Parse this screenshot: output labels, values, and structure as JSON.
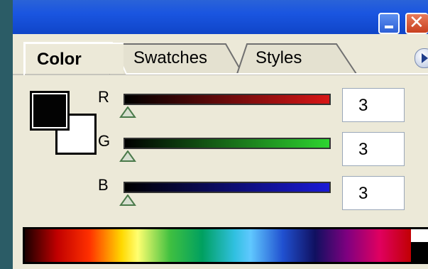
{
  "window": {
    "title_buttons": {
      "minimize_icon": "minimize-icon",
      "close_icon": "close-icon",
      "close_glyph": "✕"
    }
  },
  "tabs": [
    {
      "label": "Color",
      "active": true
    },
    {
      "label": "Swatches",
      "active": false
    },
    {
      "label": "Styles",
      "active": false
    }
  ],
  "panel_menu_icon": "panel-menu-icon",
  "swatches": {
    "foreground": "#030303",
    "background": "#ffffff"
  },
  "channels": [
    {
      "label": "R",
      "value": "3",
      "color": "#d81616"
    },
    {
      "label": "G",
      "value": "3",
      "color": "#2ed430"
    },
    {
      "label": "B",
      "value": "3",
      "color": "#1a1ad6"
    }
  ],
  "spectrum": {
    "name": "color-ramp"
  }
}
